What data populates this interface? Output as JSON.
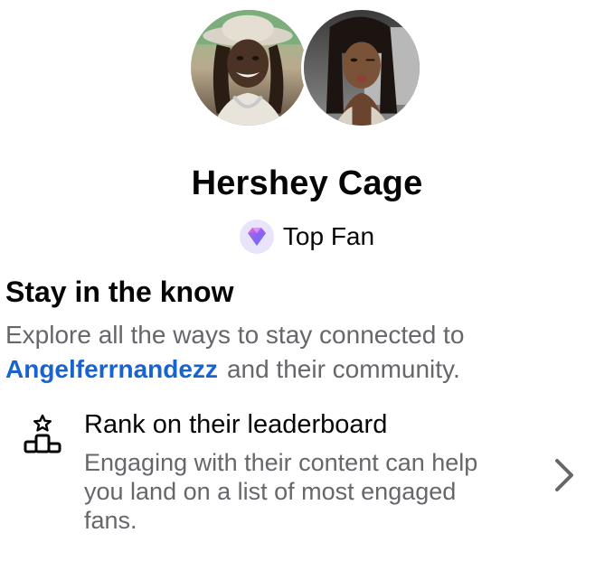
{
  "profile": {
    "name": "Hershey Cage",
    "badge_label": "Top Fan",
    "badge_icon": "diamond-icon",
    "left_avatar": "avatar-man-with-hat",
    "right_avatar": "avatar-woman"
  },
  "section": {
    "title": "Stay in the know",
    "desc_prefix": "Explore all the ways to stay connected to",
    "creator_link": "Angelferrnandezz",
    "desc_suffix": "and their community."
  },
  "leaderboard": {
    "icon": "leaderboard-podium-icon",
    "title": "Rank on their leaderboard",
    "description": "Engaging with their content can help you land on a list of most engaged fans.",
    "chevron": "chevron-right-icon"
  },
  "colors": {
    "link": "#1763cf",
    "secondary_text": "#65676b",
    "primary_text": "#050505",
    "badge_bg": "#e9e3fb"
  }
}
